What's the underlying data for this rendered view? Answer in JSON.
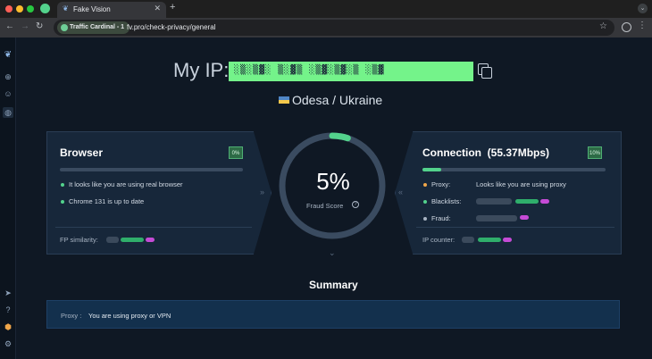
{
  "browser": {
    "tab_title": "Fake Vision",
    "profile_chip": "Traffic Cardinal - 1",
    "url": "fv.pro/check-privacy/general"
  },
  "page": {
    "my_ip_label": "My IP:",
    "ip_value": "░▒░▒▓░ ▒░▓▒ ░▒▓░▒▓░▒ ░▒▓",
    "location": "Odesa / Ukraine"
  },
  "browser_panel": {
    "title": "Browser",
    "badge": "0%",
    "progress_percent": 0,
    "items": [
      {
        "text": "It looks like you are using real browser"
      },
      {
        "text": "Chrome 131 is up to date"
      }
    ],
    "fp_label": "FP similarity:"
  },
  "gauge": {
    "value": "5%",
    "percent": 5,
    "label": "Fraud Score"
  },
  "connection_panel": {
    "title": "Connection",
    "speed": "(55.37Mbps)",
    "badge": "10%",
    "progress_percent": 10,
    "rows": [
      {
        "label": "Proxy:",
        "value": "Looks like you are using proxy"
      },
      {
        "label": "Blacklists:",
        "value": ""
      },
      {
        "label": "Fraud:",
        "value": ""
      }
    ],
    "ip_counter_label": "IP counter:"
  },
  "summary": {
    "title": "Summary",
    "label": "Proxy :",
    "text": "You are using proxy or VPN"
  },
  "colors": {
    "accent_green": "#53d28c",
    "ip_highlight": "#74f38a",
    "proxy_warn": "#f0a64a",
    "pill_magenta": "#c54bd6"
  }
}
